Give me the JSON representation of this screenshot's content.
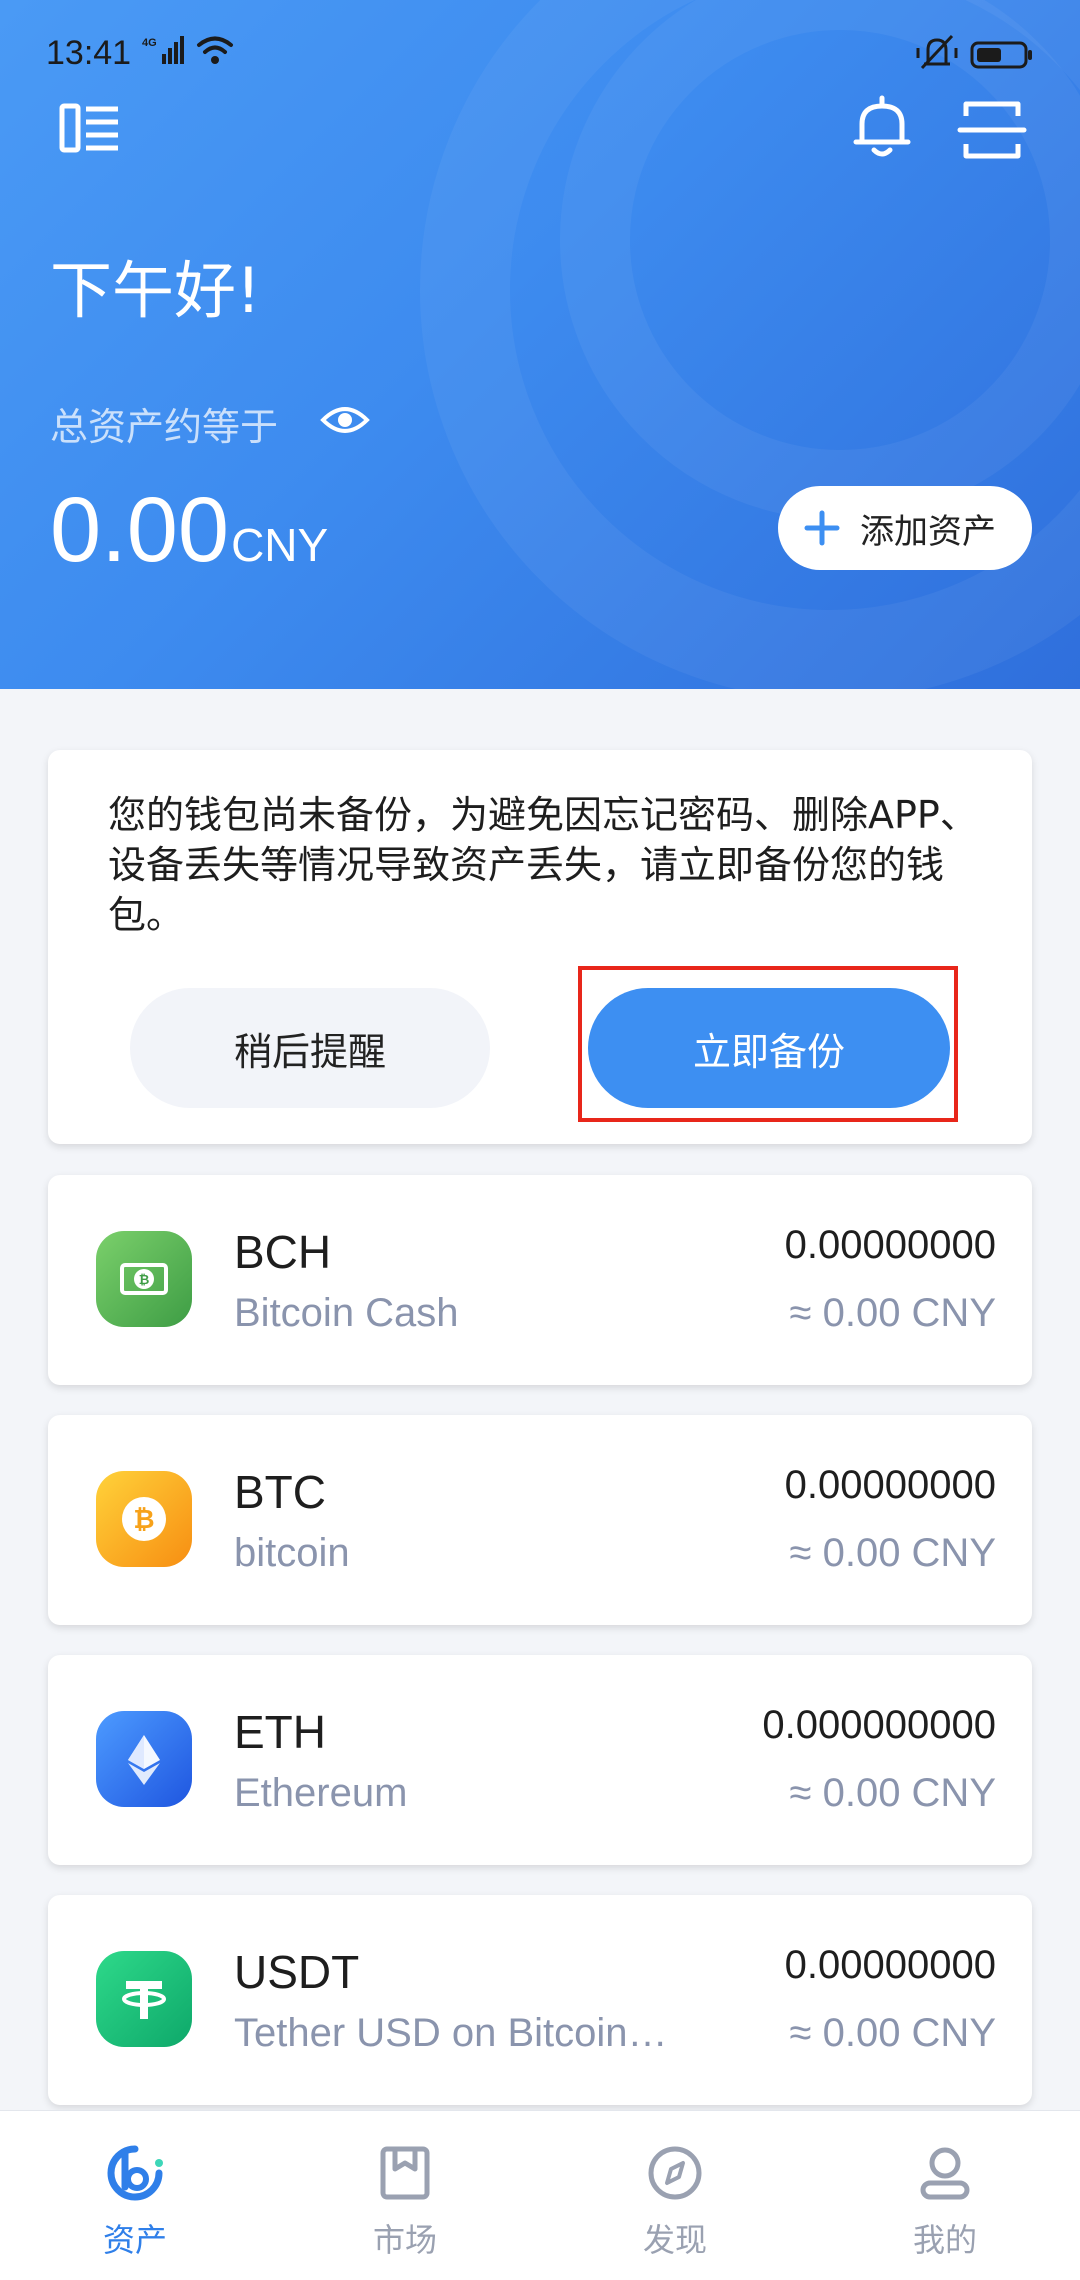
{
  "status": {
    "time": "13:41",
    "network": "4G"
  },
  "header": {
    "greeting": "下午好!",
    "total_label": "总资产约等于",
    "total_amount": "0.00",
    "currency": "CNY",
    "add_asset_label": "添加资产"
  },
  "backup": {
    "message": "您的钱包尚未备份，为避免因忘记密码、删除APP、设备丢失等情况导致资产丢失，请立即备份您的钱包。",
    "later_label": "稍后提醒",
    "now_label": "立即备份"
  },
  "tokens": [
    {
      "symbol": "BCH",
      "name": "Bitcoin Cash",
      "balance": "0.00000000",
      "value": "≈ 0.00 CNY",
      "icon": "bitcoin-cash-icon",
      "color": "#4caf50"
    },
    {
      "symbol": "BTC",
      "name": "bitcoin",
      "balance": "0.00000000",
      "value": "≈ 0.00 CNY",
      "icon": "bitcoin-icon",
      "color": "#f7a21a"
    },
    {
      "symbol": "ETH",
      "name": "Ethereum",
      "balance": "0.000000000",
      "value": "≈ 0.00 CNY",
      "icon": "ethereum-icon",
      "color": "#2f6ff0"
    },
    {
      "symbol": "USDT",
      "name": "Tether USD on Bitcoin…",
      "balance": "0.00000000",
      "value": "≈ 0.00 CNY",
      "icon": "tether-icon",
      "color": "#17c17a"
    }
  ],
  "nav": [
    {
      "label": "资产",
      "icon": "assets-icon",
      "active": true
    },
    {
      "label": "市场",
      "icon": "market-icon",
      "active": false
    },
    {
      "label": "发现",
      "icon": "discover-compass-icon",
      "active": false
    },
    {
      "label": "我的",
      "icon": "profile-icon",
      "active": false
    }
  ],
  "colors": {
    "accent": "#3d8ff2",
    "highlight_box": "#e8261a"
  }
}
